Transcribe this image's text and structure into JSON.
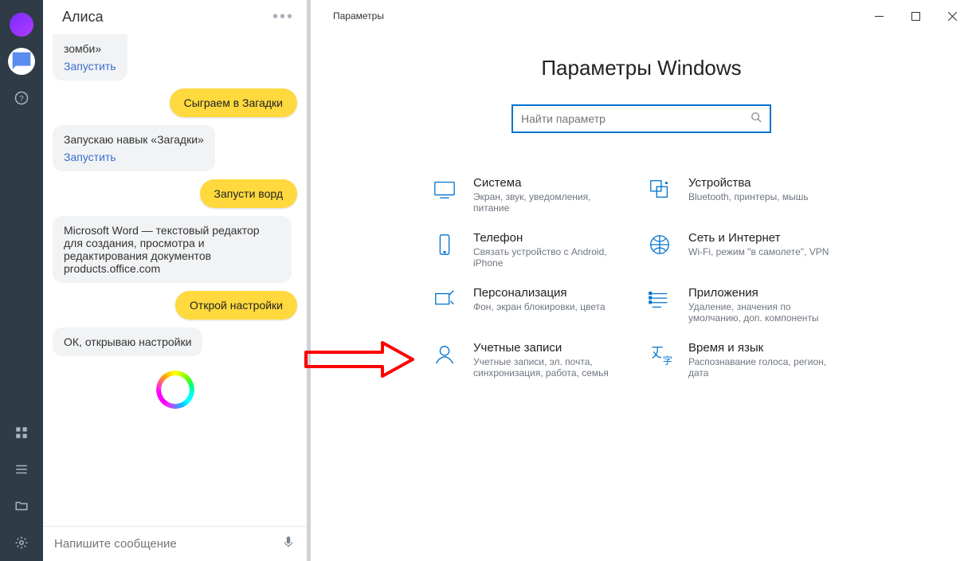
{
  "narrowBar": {
    "tooltip_alice": "Алиса"
  },
  "alice": {
    "title": "Алиса",
    "messages": {
      "m0_text": "зомби»",
      "m0_link": "Запустить",
      "m1_text": "Сыграем в Загадки",
      "m2_text": "Запускаю навык «Загадки»",
      "m2_link": "Запустить",
      "m3_text": "Запусти ворд",
      "m4_text": "Microsoft Word — текстовый редактор для создания, просмотра и редактирования документов products.office.com",
      "m5_text": "Открой настройки",
      "m6_text": "ОК, открываю настройки"
    },
    "input_placeholder": "Напишите сообщение"
  },
  "settings": {
    "window_title": "Параметры",
    "page_title": "Параметры Windows",
    "search_placeholder": "Найти параметр",
    "items": [
      {
        "title": "Система",
        "desc": "Экран, звук, уведомления, питание"
      },
      {
        "title": "Устройства",
        "desc": "Bluetooth, принтеры, мышь"
      },
      {
        "title": "Телефон",
        "desc": "Связать устройство с Android, iPhone"
      },
      {
        "title": "Сеть и Интернет",
        "desc": "Wi-Fi, режим \"в самолете\", VPN"
      },
      {
        "title": "Персонализация",
        "desc": "Фон, экран блокировки, цвета"
      },
      {
        "title": "Приложения",
        "desc": "Удаление, значения по умолчанию, доп. компоненты"
      },
      {
        "title": "Учетные записи",
        "desc": "Учетные записи, эл. почта, синхронизация, работа, семья"
      },
      {
        "title": "Время и язык",
        "desc": "Распознавание голоса, регион, дата"
      }
    ]
  }
}
